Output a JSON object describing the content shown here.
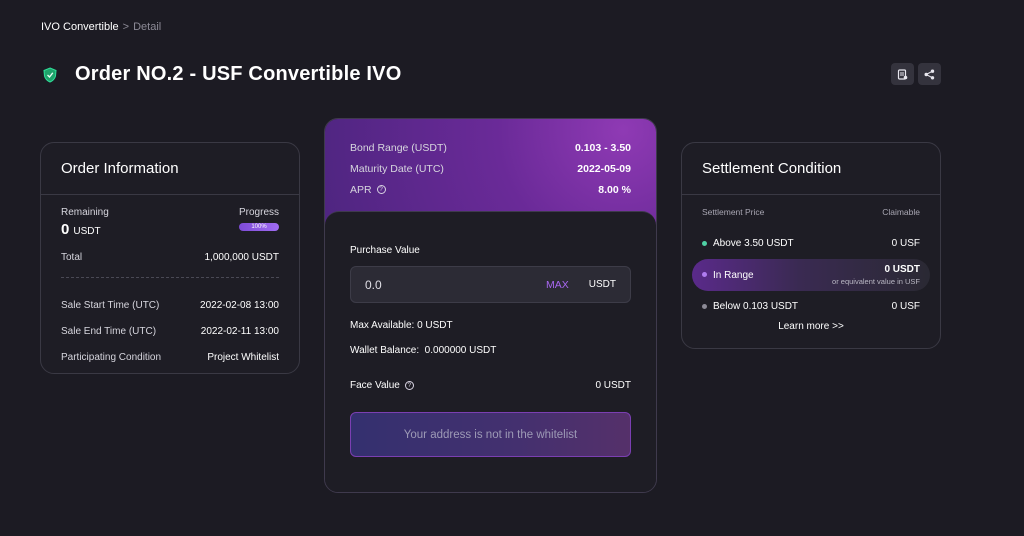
{
  "breadcrumb": {
    "parent": "IVO Convertible",
    "separator": ">",
    "current": "Detail"
  },
  "page": {
    "title": "Order NO.2 - USF Convertible IVO"
  },
  "order_info": {
    "title": "Order Information",
    "remaining_label": "Remaining",
    "remaining_value": "0",
    "remaining_unit": "USDT",
    "progress_label": "Progress",
    "progress_value": "100%",
    "total_label": "Total",
    "total_value": "1,000,000 USDT",
    "sale_start_label": "Sale Start Time (UTC)",
    "sale_start_value": "2022-02-08 13:00",
    "sale_end_label": "Sale End Time (UTC)",
    "sale_end_value": "2022-02-11 13:00",
    "participating_label": "Participating Condition",
    "participating_value": "Project Whitelist"
  },
  "bond": {
    "range_label": "Bond Range (USDT)",
    "range_value": "0.103 - 3.50",
    "maturity_label": "Maturity Date (UTC)",
    "maturity_value": "2022-05-09",
    "apr_label": "APR",
    "apr_value": "8.00 %"
  },
  "purchase": {
    "label": "Purchase Value",
    "input_value": "0.0",
    "max_label": "MAX",
    "unit": "USDT",
    "max_available": "Max Available: 0 USDT",
    "wallet_balance": "Wallet Balance:  0.000000 USDT",
    "face_value_label": "Face Value",
    "face_value": "0 USDT",
    "whitelist_message": "Your address is not in the whitelist"
  },
  "settlement": {
    "title": "Settlement Condition",
    "price_header": "Settlement Price",
    "claimable_header": "Claimable",
    "above_label": "Above 3.50 USDT",
    "above_value": "0 USF",
    "inrange_label": "In Range",
    "inrange_value": "0 USDT",
    "inrange_sub": "or equivalent value in USF",
    "below_label": "Below 0.103 USDT",
    "below_value": "0 USF",
    "learn_more": "Learn more >>"
  },
  "colors": {
    "accent": "#a867f0",
    "above_dot": "#4fd1a5",
    "inrange_dot": "#b07cf0",
    "below_dot": "#8c8a96"
  },
  "icons": {
    "title": "shield-icon",
    "actions": [
      "document-icon",
      "share-icon"
    ]
  }
}
